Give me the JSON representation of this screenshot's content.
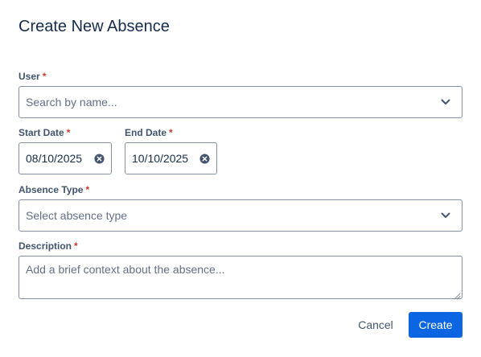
{
  "dialog": {
    "title": "Create New Absence"
  },
  "user": {
    "label": "User",
    "required_mark": "*",
    "placeholder": "Search by name..."
  },
  "start_date": {
    "label": "Start Date",
    "required_mark": "*",
    "value": "08/10/2025"
  },
  "end_date": {
    "label": "End Date",
    "required_mark": "*",
    "value": "10/10/2025"
  },
  "absence_type": {
    "label": "Absence Type",
    "required_mark": "*",
    "placeholder": "Select absence type"
  },
  "description": {
    "label": "Description",
    "required_mark": "*",
    "placeholder": "Add a brief context about the absence..."
  },
  "actions": {
    "cancel_label": "Cancel",
    "create_label": "Create"
  },
  "icons": {
    "dropdown": "chevron-down-icon",
    "clear": "clear-icon",
    "resize": "resize-handle-icon"
  },
  "colors": {
    "primary": "#0c66e4",
    "required": "#c9372c",
    "border": "#8590a2",
    "text": "#172b4d",
    "placeholder": "#626f86"
  }
}
